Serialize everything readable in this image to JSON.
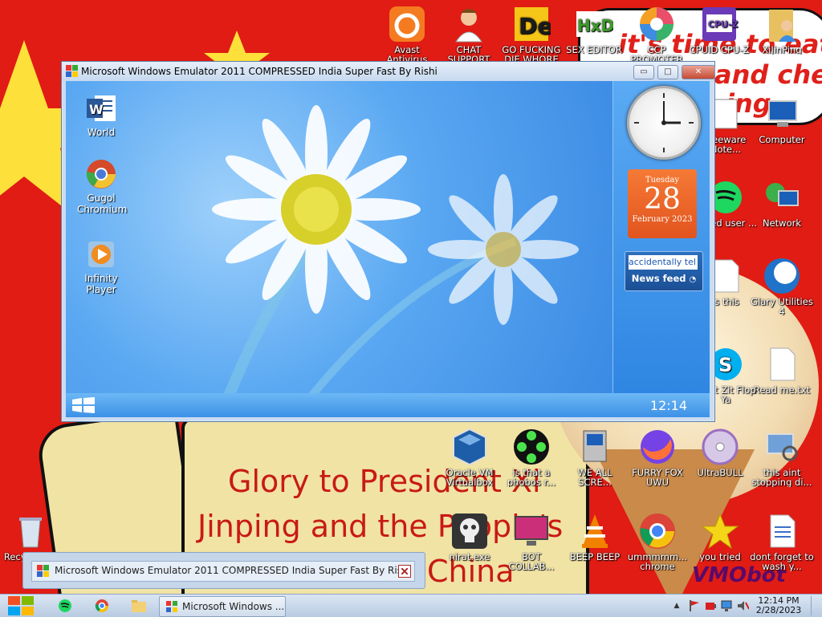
{
  "wallpaper": {
    "slogan_line1": "Glory to President Xi",
    "slogan_line2": "Jinping and the People's",
    "slogan_line3": "China",
    "bubble_line1": "it's time to eat shit",
    "bubble_line2": "and chew",
    "bubble_line3": "ing",
    "signature": "VMObot"
  },
  "desktop_icons": [
    {
      "label": "Avast Antivirus",
      "icon": "avast-icon",
      "color": "#f47b20"
    },
    {
      "label": "CHAT SUPPORT",
      "icon": "doctor-icon",
      "color": "#ffffff"
    },
    {
      "label": "GO FUCKING DIE WHORE",
      "icon": "de-icon",
      "color": "#1b1b1b"
    },
    {
      "label": "SEX EDITOR",
      "icon": "hxd-icon",
      "color": "#ffffff"
    },
    {
      "label": "CCP PROMOTER",
      "icon": "color-wheel-icon",
      "color": "#e94f6a"
    },
    {
      "label": "CPUID CPU-Z",
      "icon": "cpuz-icon",
      "color": "#6a3ab8"
    },
    {
      "label": "XiJinPing",
      "icon": "folder-person-icon",
      "color": "#e8c060"
    },
    {
      "label": "Computer",
      "icon": "computer-icon",
      "color": "#3a8de0"
    },
    {
      "label": "Network",
      "icon": "network-icon",
      "color": "#3a8de0"
    },
    {
      "label": "Glary Utilities 4",
      "icon": "glary-icon",
      "color": "#1f73c8"
    },
    {
      "label": "Read me.txt",
      "icon": "text-file-icon",
      "color": "#ffffff"
    },
    {
      "label": "this aint stopping di...",
      "icon": "computer-magnifier-icon",
      "color": "#6fa0d8"
    },
    {
      "label": "dont forget to wash y...",
      "icon": "document-icon",
      "color": "#ffffff"
    },
    {
      "label": "you tried",
      "icon": "star-icon",
      "color": "#f5d518"
    },
    {
      "label": "ummmmm... chrome",
      "icon": "chrome-icon",
      "color": "#db4437"
    },
    {
      "label": "BEEP BEEP",
      "icon": "vlc-icon",
      "color": "#f08200"
    },
    {
      "label": "BOT COLLAB...",
      "icon": "monitor-pink-icon",
      "color": "#cc2f7a"
    },
    {
      "label": "nirat.exe",
      "icon": "skull-icon",
      "color": "#e0e0e0"
    },
    {
      "label": "Oracle VM Virtualbox",
      "icon": "virtualbox-icon",
      "color": "#1e5ea8"
    },
    {
      "label": "is that a phobos r...",
      "icon": "green-flower-icon",
      "color": "#4be34b"
    },
    {
      "label": "WE ALL SCRE...",
      "icon": "computer-sparkle-icon",
      "color": "#c0c0c0"
    },
    {
      "label": "FURRY FOX UWU",
      "icon": "firefox-icon",
      "color": "#ff7139"
    },
    {
      "label": "UltraBULL",
      "icon": "disc-icon",
      "color": "#9b6fc0"
    },
    {
      "label": "Recycle Bin",
      "icon": "recycle-bin-icon",
      "color": "#d8e4f0"
    },
    {
      "label": "freeware Note...",
      "icon": "notepad-icon",
      "color": "#ffffff"
    },
    {
      "label": "based user ...",
      "icon": "spotify-icon",
      "color": "#1ed760"
    },
    {
      "label": "is this",
      "icon": "document-icon",
      "color": "#ffffff"
    },
    {
      "label": "what Zit Flop Ya",
      "icon": "skype-icon",
      "color": "#00aff0"
    }
  ],
  "emulator_window": {
    "title": "Microsoft Windows Emulator 2011 COMPRESSED India Super Fast By Rishi",
    "minimize_glyph": "▭",
    "maximize_glyph": "□",
    "close_glyph": "✕",
    "icons": [
      {
        "label": "World",
        "icon": "word-icon"
      },
      {
        "label": "Gugol Chromium",
        "icon": "chromium-icon"
      },
      {
        "label": "Infinity Player",
        "icon": "media-player-icon"
      }
    ],
    "calendar": {
      "weekday": "Tuesday",
      "day": "28",
      "month_year": "February 2023"
    },
    "news": {
      "ticker": "accidentally tel",
      "feed_label": "News feed"
    },
    "clock_text": "12:14"
  },
  "minimized_bar": {
    "title": "Microsoft Windows Emulator 2011 COMPRESSED India Super Fast By Rishi"
  },
  "taskbar": {
    "active_task": "Microsoft Windows ...",
    "time": "12:14 PM",
    "date": "2/28/2023",
    "up_arrow": "▲"
  }
}
